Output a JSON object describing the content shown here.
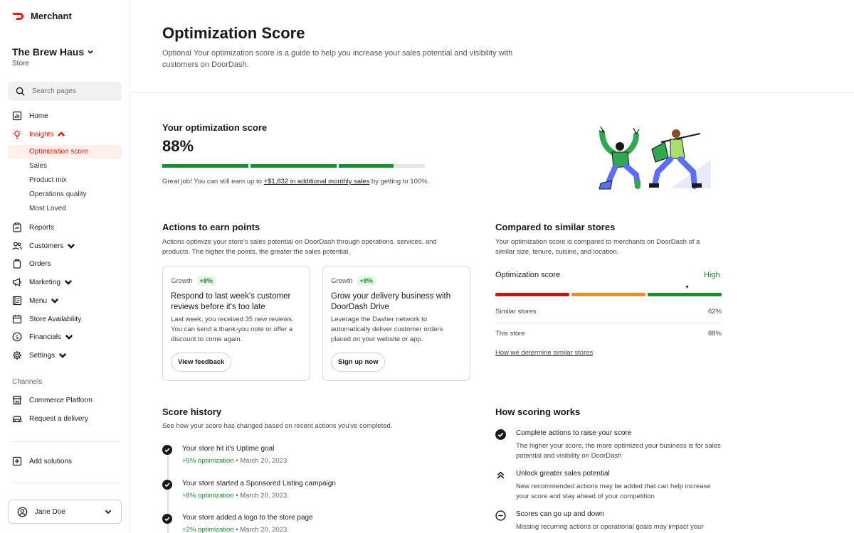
{
  "brand": {
    "name": "Merchant"
  },
  "store": {
    "name": "The Brew Haus",
    "type": "Store"
  },
  "search": {
    "placeholder": "Search pages"
  },
  "nav": {
    "home": "Home",
    "insights": "Insights",
    "insights_sub": [
      "Optimization score",
      "Sales",
      "Product mix",
      "Operations quality",
      "Most Loved"
    ],
    "reports": "Reports",
    "customers": "Customers",
    "orders": "Orders",
    "marketing": "Marketing",
    "menu": "Menu",
    "store_availability": "Store Availability",
    "financials": "Financials",
    "settings": "Settings",
    "channels_label": "Channels",
    "commerce_platform": "Commerce Platform",
    "request_delivery": "Request a delivery",
    "add_solutions": "Add solutions"
  },
  "user": {
    "name": "Jane Doe"
  },
  "header": {
    "title": "Optimization Score",
    "subtitle": "Optional Your optimization score is a guide to help you increase your sales potential and visibility with customers on DoorDash."
  },
  "score": {
    "heading": "Your optimization score",
    "value": "88%",
    "progress_fraction": 0.88,
    "message_prefix": "Great job! You can still earn up to ",
    "message_link": "+$1,832 in additional monthly sales",
    "message_suffix": " by getting to 100%."
  },
  "actions": {
    "heading": "Actions to earn points",
    "desc": "Actions optimize your store's sales potential on DoorDash through operations, services, and products. The higher the points, the greater the sales potential.",
    "cards": [
      {
        "tag": "Growth",
        "badge": "+8%",
        "title": "Respond to last week's customer reviews before it's too late",
        "desc": "Last week, you received 35 new reviews. You can send a thank-you note or offer a discount to come again.",
        "button": "View feedback"
      },
      {
        "tag": "Growth",
        "badge": "+8%",
        "title": "Grow your delivery business with DoorDash Drive",
        "desc": "Leverage the Dasher network to automatically deliver customer orders placed on your website or app.",
        "button": "Sign up now"
      }
    ]
  },
  "compare": {
    "heading": "Compared to similar stores",
    "desc": "Your optimization score is compared to merchants on DoorDash of a similar size, tenure, cuisine, and location.",
    "label": "Optimization score",
    "level": "High",
    "colors": {
      "low": "#b71c1c",
      "mid": "#ec8a2c",
      "high": "#1f8a33"
    },
    "rows": [
      {
        "label": "Similar stores",
        "value": "62%"
      },
      {
        "label": "This store",
        "value": "88%"
      }
    ],
    "link": "How we determine similar stores"
  },
  "history": {
    "heading": "Score history",
    "desc": "See how your score has changed based on recent actions you've completed.",
    "items": [
      {
        "title": "Your store hit it's Uptime goal",
        "gain": "+5% optimization",
        "date": "March 20, 2023"
      },
      {
        "title": "Your store started a Sponsored Listing campaign",
        "gain": "+8% optimization",
        "date": "March 20, 2023"
      },
      {
        "title": "Your store added a logo to the store page",
        "gain": "+2% optimization",
        "date": "March 20, 2023"
      }
    ]
  },
  "how": {
    "heading": "How scoring works",
    "items": [
      {
        "icon": "check-circle-icon",
        "title": "Complete actions to raise your score",
        "desc": "The higher your score, the more optimized your business is for sales potential and visibility on DoorDash"
      },
      {
        "icon": "double-chevron-up-icon",
        "title": "Unlock greater sales potential",
        "desc": "New recommended actions may be added that can help increase your score and stay ahead of your competition"
      },
      {
        "icon": "minus-circle-icon",
        "title": "Scores can go up and down",
        "desc": "Missing recurring actions or operational goals may impact your"
      }
    ]
  },
  "accent": "#eb1700",
  "success": "#1f8a33"
}
